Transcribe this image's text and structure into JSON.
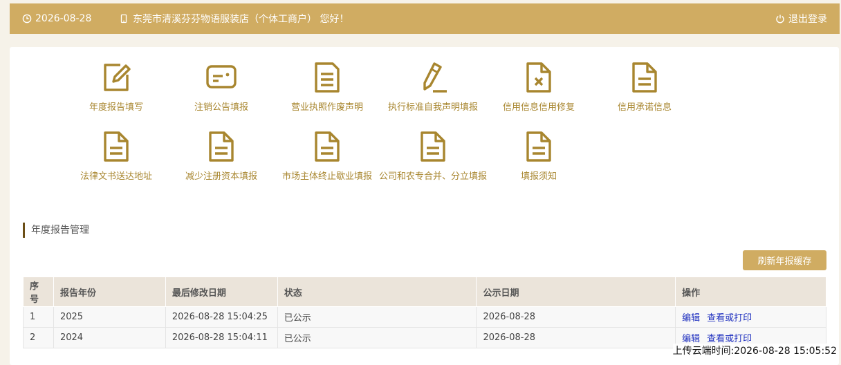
{
  "header": {
    "date": "2026-08-28",
    "shop_greeting": "东莞市清溪芬芬物语服装店（个体工商户） 您好！",
    "logout_label": "退出登录"
  },
  "tiles": [
    {
      "label": "年度报告填写",
      "icon": "edit-document-icon"
    },
    {
      "label": "注销公告填报",
      "icon": "id-card-icon"
    },
    {
      "label": "营业执照作废声明",
      "icon": "document-icon"
    },
    {
      "label": "执行标准自我声明填报",
      "icon": "pencil-icon"
    },
    {
      "label": "信用信息信用修复",
      "icon": "document-x-icon"
    },
    {
      "label": "信用承诺信息",
      "icon": "document-icon"
    },
    {
      "label": "法律文书送达地址",
      "icon": "document-icon"
    },
    {
      "label": "减少注册资本填报",
      "icon": "document-icon"
    },
    {
      "label": "市场主体终止歇业填报",
      "icon": "document-icon"
    },
    {
      "label": "公司和农专合并、分立填报",
      "icon": "document-icon"
    },
    {
      "label": "填报须知",
      "icon": "document-icon"
    }
  ],
  "section": {
    "title": "年度报告管理",
    "refresh_label": "刷新年报缓存"
  },
  "table": {
    "headers": [
      "序号",
      "报告年份",
      "最后修改日期",
      "状态",
      "公示日期",
      "操作"
    ],
    "rows": [
      {
        "no": "1",
        "year": "2025",
        "modified": "2026-08-28 15:04:25",
        "status": "已公示",
        "pub_date": "2026-08-28",
        "edit": "编辑",
        "view": "查看或打印"
      },
      {
        "no": "2",
        "year": "2024",
        "modified": "2026-08-28 15:04:11",
        "status": "已公示",
        "pub_date": "2026-08-28",
        "edit": "编辑",
        "view": "查看或打印"
      }
    ]
  },
  "upload_time": "上传云端时间:2026-08-28 15:05:52",
  "colors": {
    "accent": "#d0ac62",
    "icon": "#a8862f",
    "link": "#1e2fbf"
  }
}
